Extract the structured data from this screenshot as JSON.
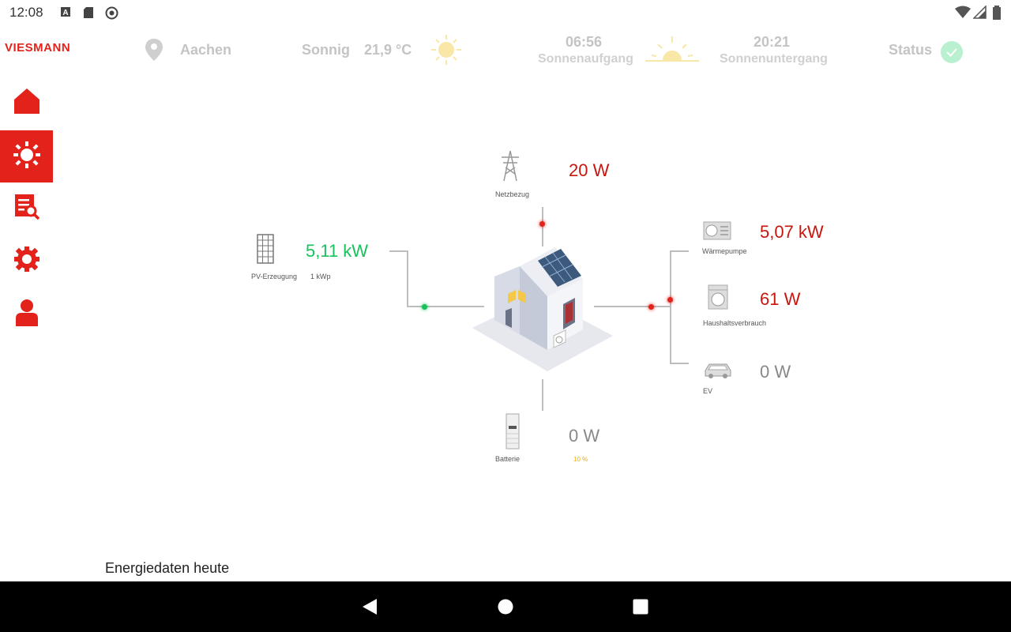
{
  "status_bar": {
    "time": "12:08",
    "icons": [
      "font-icon",
      "sd-card-icon",
      "sync-icon",
      "wifi-icon",
      "signal-icon",
      "battery-icon"
    ]
  },
  "header": {
    "brand": "VIESMANN",
    "location": "Aachen",
    "weather": "Sonnig",
    "temperature": "21,9 °C",
    "sunrise_time": "06:56",
    "sunrise_label": "Sonnenaufgang",
    "sunset_time": "20:21",
    "sunset_label": "Sonnenuntergang",
    "status_label": "Status"
  },
  "sidebar": {
    "items": [
      {
        "name": "home",
        "active": false
      },
      {
        "name": "sun",
        "active": true
      },
      {
        "name": "report-search",
        "active": false
      },
      {
        "name": "settings",
        "active": false
      },
      {
        "name": "user",
        "active": false
      }
    ]
  },
  "flow": {
    "grid": {
      "value": "20 W",
      "label": "Netzbezug"
    },
    "pv": {
      "value": "5,11 kW",
      "label": "PV-Erzeugung",
      "capacity": "1 kWp"
    },
    "heat_pump": {
      "value": "5,07 kW",
      "label": "Wärmepumpe"
    },
    "household": {
      "value": "61 W",
      "label": "Haushaltsverbrauch"
    },
    "ev": {
      "value": "0 W",
      "label": "EV"
    },
    "battery": {
      "value": "0 W",
      "label": "Batterie",
      "soc": "10 %"
    }
  },
  "footer": {
    "title": "Energiedaten heute"
  },
  "colors": {
    "brand_red": "#e3231b",
    "value_red": "#c8160e",
    "value_green": "#19c15c",
    "status_ok": "#3ddc84"
  }
}
